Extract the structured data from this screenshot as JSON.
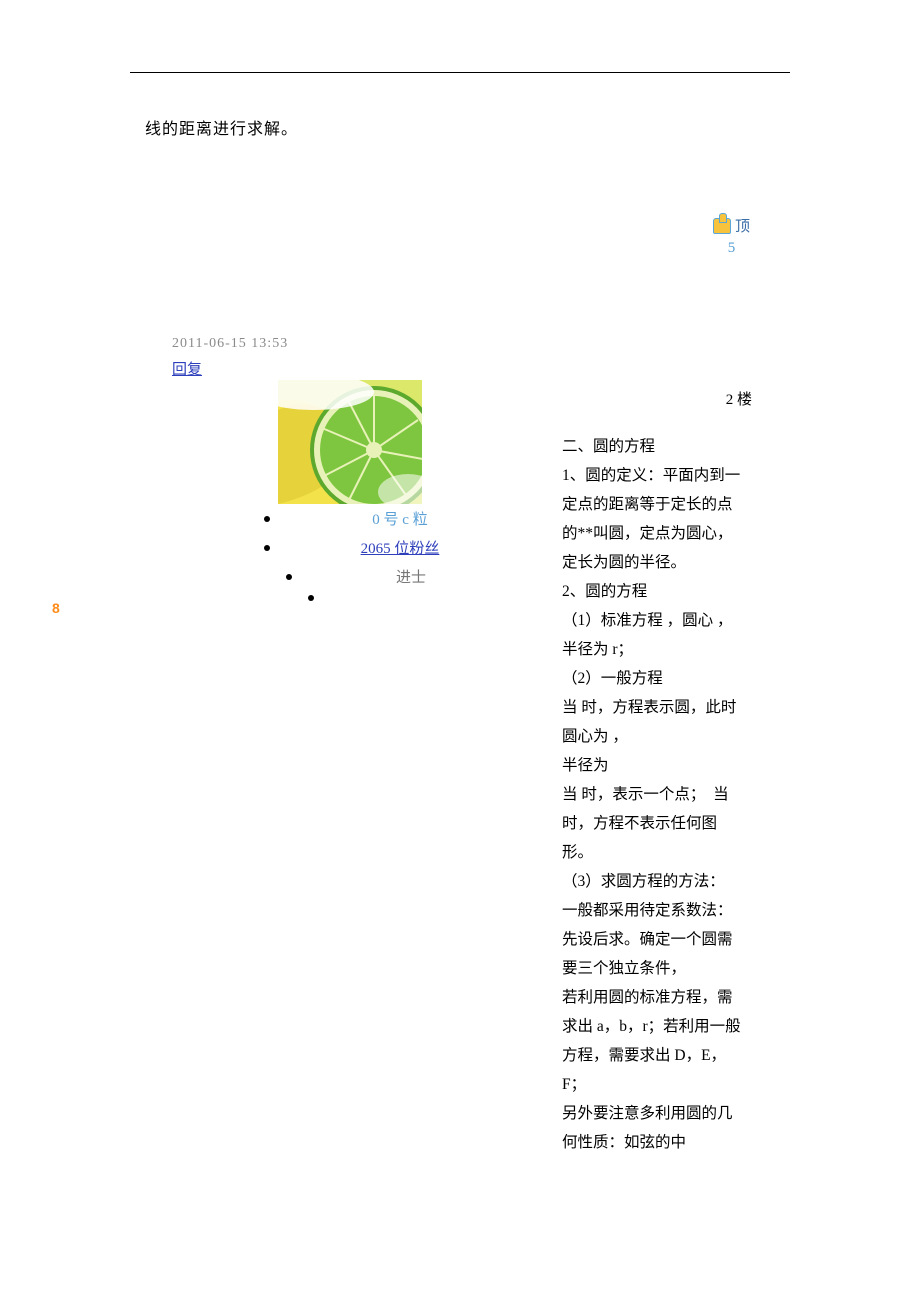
{
  "fragment": "线的距离进行求解。",
  "like": {
    "label": "顶",
    "count": "5"
  },
  "post_meta": {
    "timestamp": "2011-06-15 13:53",
    "reply_label": "回复",
    "floor": "2 楼"
  },
  "user": {
    "name": "0 号 c 粒",
    "fans_count": "2065 位粉丝",
    "rank": "进士"
  },
  "side_marker": "8",
  "content": {
    "h1": "二、圆的方程",
    "p1": "1、圆的定义：平面内到一定点的距离等于定长的点的**叫圆，定点为圆心，定长为圆的半径。",
    "p2": "2、圆的方程",
    "p3": "（1）标准方程 ，圆心 ，半径为 r；",
    "p4": "（2）一般方程",
    "p5": "当 时，方程表示圆，此时圆心为 ，",
    "p6": "半径为",
    "p7": "当 时，表示一个点；  当 时，方程不表示任何图形。",
    "p8": "（3）求圆方程的方法：",
    "p9": "一般都采用待定系数法：先设后求。确定一个圆需要三个独立条件，",
    "p10": "若利用圆的标准方程，需求出 a，b，r；若利用一般方程，需要求出 D，E，F；",
    "p11": "另外要注意多利用圆的几何性质：如弦的中"
  }
}
